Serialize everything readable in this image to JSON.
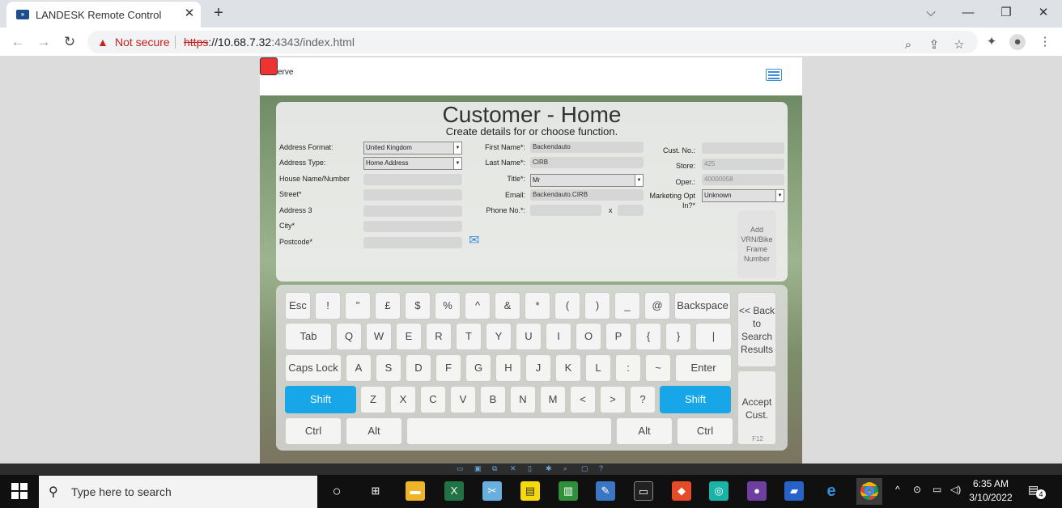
{
  "browser": {
    "tab_title": "LANDESK Remote Control",
    "tab_favicon": "landesk-icon",
    "close_tab": "✕",
    "new_tab": "+",
    "url_warning": "Not secure",
    "url_scheme": "https",
    "url_rest": "://10.68.7.32",
    "url_port_path": ":4343/index.html",
    "window_controls": {
      "dropdown": "⌵",
      "minimize": "—",
      "restore": "❐",
      "close": "✕"
    }
  },
  "app": {
    "logo_text": "erve",
    "title": "Customer - Home",
    "subtitle": "Create details for   or choose function.",
    "address": {
      "format_label": "Address Format:",
      "format_value": "United Kingdom",
      "type_label": "Address Type:",
      "type_value": "Home Address",
      "house_label": "House Name/Number",
      "street_label": "Street*",
      "address3_label": "Address 3",
      "city_label": "City*",
      "postcode_label": "Postcode*"
    },
    "person": {
      "first_name_label": "First Name*:",
      "first_name_value": "Backendauto",
      "last_name_label": "Last Name*:",
      "last_name_value": "CIRB",
      "title_label": "Title*:",
      "title_value": "Mr",
      "email_label": "Email:",
      "email_value": "Backendauto.CIRB",
      "phone_label": "Phone No.*:",
      "phone_ext_label": "x"
    },
    "customer": {
      "cust_no_label": "Cust. No.:",
      "cust_no_value": "",
      "store_label": "Store:",
      "store_value": "425",
      "oper_label": "Oper.:",
      "oper_value": "40000058",
      "marketing_label": "Marketing Opt In?*",
      "marketing_value": "Unknown"
    },
    "side_buttons": {
      "add_vrn": "Add VRN/Bike Frame Number",
      "back_to_search": "<< Back to Search Results",
      "accept_cust": "Accept Cust.",
      "accept_hint": "F12"
    },
    "keyboard": {
      "row1": [
        "Esc",
        "!",
        "\"",
        "£",
        "$",
        "%",
        "^",
        "&",
        "*",
        "(",
        ")",
        "_",
        "@",
        "Backspace"
      ],
      "row2": [
        "Tab",
        "Q",
        "W",
        "E",
        "R",
        "T",
        "Y",
        "U",
        "I",
        "O",
        "P",
        "{",
        "}",
        "|"
      ],
      "row3": [
        "Caps Lock",
        "A",
        "S",
        "D",
        "F",
        "G",
        "H",
        "J",
        "K",
        "L",
        ":",
        "~",
        "Enter"
      ],
      "row4": [
        "Shift",
        "Z",
        "X",
        "C",
        "V",
        "B",
        "N",
        "M",
        "<",
        ">",
        "?",
        "Shift"
      ],
      "row5": [
        "Ctrl",
        "Alt",
        "",
        "Alt",
        "Ctrl"
      ]
    }
  },
  "taskbar": {
    "search_placeholder": "Type here to search",
    "time": "6:35 AM",
    "date": "3/10/2022",
    "notifications": "4"
  },
  "colors": {
    "accent_blue": "#17a6e8",
    "warning_red": "#c5221f"
  }
}
